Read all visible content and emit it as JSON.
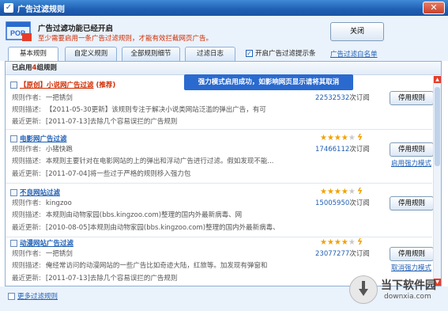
{
  "window": {
    "title": "广告过滤规则"
  },
  "header": {
    "title": "广告过滤功能已经开启",
    "subtitle": "至少需要启用一条广告过滤规则，才能有效拦截网页广告。",
    "main_button": "关闭"
  },
  "tabs": [
    {
      "label": "基本规则",
      "active": true
    },
    {
      "label": "自定义规则",
      "active": false
    },
    {
      "label": "全部规则细节",
      "active": false
    },
    {
      "label": "过滤日志",
      "active": false
    }
  ],
  "tips_checkbox": {
    "label": "开启广告过滤提示条",
    "checked": true
  },
  "whitelist_link": "广告过滤白名单",
  "panel": {
    "header_prefix": "已启用",
    "header_count": "4",
    "header_suffix": "组规则",
    "toast": "强力模式启用成功，如影响网页显示请将其取消"
  },
  "labels": {
    "author": "规则作者:",
    "desc": "规则描述:",
    "updated": "最近更新:",
    "count_suffix": "次订阅",
    "stop_button": "停用规则"
  },
  "rules": [
    {
      "name": "【原创】小说网广告过滤",
      "tag": "(推荐)",
      "author": "一把锈剑",
      "desc": "【2011-05-30更新】该规则专注于解决小说类网站泛滥的弹出广告，有可",
      "updated": "[2011-07-13]去除几个容易误拦的广告规则",
      "count": "22532532",
      "rating": 0,
      "side_link": ""
    },
    {
      "name": "电影网广告过滤",
      "tag": "",
      "author": "小猪快跑",
      "desc": "本规则主要针对在电影网站的上的弹出和浮动广告进行过滤。假如发现不能...",
      "updated": "[2011-07-04]将一些过于严格的规则移入强力包",
      "count": "17466112",
      "rating": 4,
      "side_link": "启用强力模式"
    },
    {
      "name": "不良网站过滤",
      "tag": "",
      "author": "kingzoo",
      "desc": "本规则由动物家园(bbs.kingzoo.com)整理的国内外最新病毒、网",
      "updated": "[2010-08-05]本规则由动物家园(bbs.kingzoo.com)整理的国内外最新病毒、",
      "count": "15005950",
      "rating": 4,
      "side_link": ""
    },
    {
      "name": "动漫网站广告过滤",
      "tag": "",
      "author": "一把锈剑",
      "desc": "俺经常访问的动漫网站的一些广告比如奇迹大陆，红旅等。加发现有弹窗和",
      "updated": "[2011-07-13]去除几个容易误拦的广告规则",
      "count": "23077277",
      "rating": 4,
      "side_link": "取消强力模式"
    }
  ],
  "footer": {
    "more_link": "更多过滤规则"
  },
  "watermark": {
    "name": "当下软件园",
    "url": "downxia.com"
  },
  "colors": {
    "accent": "#1f5fb4",
    "highlight": "#d02b00",
    "toast": "#2a6acf",
    "star": "#f2a100"
  }
}
